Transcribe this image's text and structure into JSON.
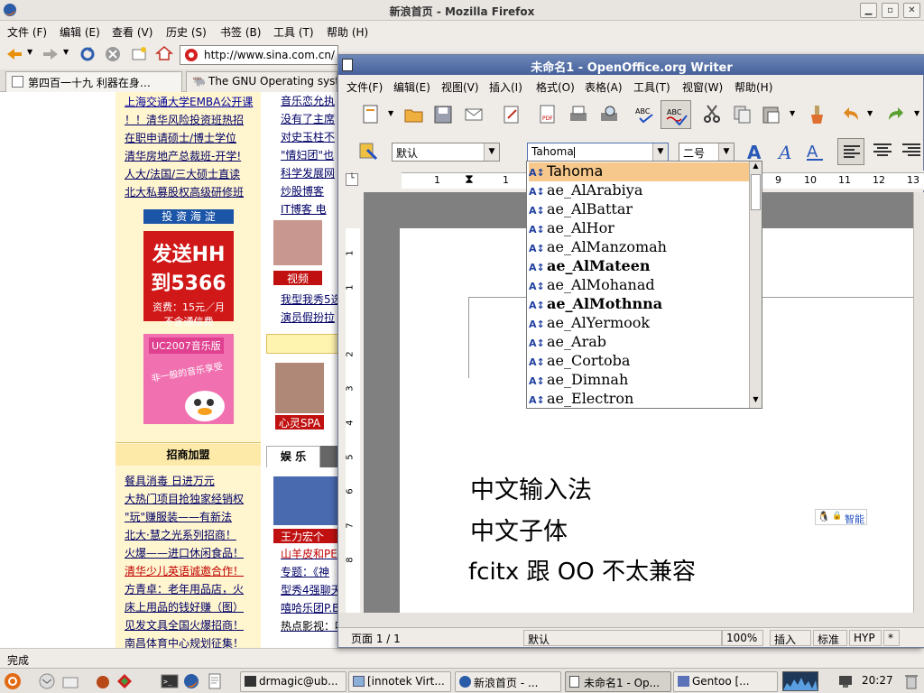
{
  "firefox": {
    "window_title": "新浪首页 - Mozilla Firefox",
    "menu": [
      "文件 (F)",
      "编辑 (E)",
      "查看 (V)",
      "历史 (S)",
      "书签 (B)",
      "工具 (T)",
      "帮助 (H)"
    ],
    "url": "http://www.sina.com.cn/",
    "tabs": [
      "第四百一十九 利器在身…",
      "The GNU Operating syst…"
    ],
    "status": "完成"
  },
  "sina": {
    "left_links_top": [
      "上海交通大学EMBA公开课",
      "！！清华风险投资班热招",
      "在职申请硕士/博士学位",
      "清华房地产总裁班-开学!",
      "人大/法国/三大硕士直读",
      "北大私募股权高级研修班"
    ],
    "invest_banner": "投 资 海 淀",
    "ad_hh_line1": "发送HH",
    "ad_hh_line2": "到5366",
    "ad_hh_fee": "资费：15元／月",
    "ad_hh_note": "不含通信费",
    "ad_uc_title": "UC2007音乐版",
    "ad_uc_slogan": "非一般的音乐享受",
    "zhaoshang_title": "招商加盟",
    "zhaoshang_links": [
      "餐具消毒 日进万元",
      "大热门项目抢独家经销权",
      "\"玩\"赚服装——有新法",
      "北大·慧之光系列招商！",
      "火爆——进口休闲食品！",
      "清华少儿英语诚邀合作！",
      "方青卓：老年用品店，火",
      "床上用品的钱好赚（图）",
      "见发文具全国火爆招商！",
      "南昌体育中心规划征集！"
    ],
    "mid_links_top": [
      "音乐恋允执",
      "没有了主席",
      "对史玉柱不",
      "\"情妇团\"也",
      "科学发展网",
      "炒股博客",
      "IT博客 电"
    ],
    "video_label": "视频",
    "mid_links_mid": [
      "我型我秀5选",
      "演员假扮拉"
    ],
    "spa_label": "心灵SPA",
    "ent_tab": "娱 乐",
    "wang_label": "王力宏个",
    "mid_links_bottom": [
      "山羊皮和PE",
      "专题：《神",
      "型秀4强聊天",
      "嘻哈乐团P.B",
      "热点影视：哈"
    ]
  },
  "writer": {
    "window_title": "未命名1 - OpenOffice.org Writer",
    "menu": [
      "文件(F)",
      "编辑(E)",
      "视图(V)",
      "插入(I)",
      "格式(O)",
      "表格(A)",
      "工具(T)",
      "视窗(W)",
      "帮助(H)"
    ],
    "style_value": "默认",
    "font_value": "Tahoma",
    "size_value": "二号",
    "ruler_numbers": [
      "1",
      "1",
      "9",
      "10",
      "11",
      "12",
      "13"
    ],
    "vruler_numbers": [
      "1",
      "1",
      "2",
      "3",
      "4",
      "5",
      "6",
      "7",
      "8"
    ],
    "font_list": [
      "Tahoma",
      "ae_AlArabiya",
      "ae_AlBattar",
      "ae_AlHor",
      "ae_AlManzomah",
      "ae_AlMateen",
      "ae_AlMohanad",
      "ae_AlMothnna",
      "ae_AlYermook",
      "ae_Arab",
      "ae_Cortoba",
      "ae_Dimnah",
      "ae_Electron"
    ],
    "doc_lines": [
      "中文输入法",
      "中文子体",
      "fcitx 跟 OO 不太兼容"
    ],
    "ime_label": "智能",
    "status_page": "页面 1 / 1",
    "status_style": "默认",
    "status_zoom": "100%",
    "status_insert": "插入",
    "status_std": "标准",
    "status_hyp": "HYP",
    "status_star": "*"
  },
  "taskbar": {
    "items": [
      "drmagic@ub...",
      "[innotek Virt...",
      "新浪首页 - ...",
      "未命名1 - Op...",
      "Gentoo [..."
    ],
    "time": "20:27"
  }
}
